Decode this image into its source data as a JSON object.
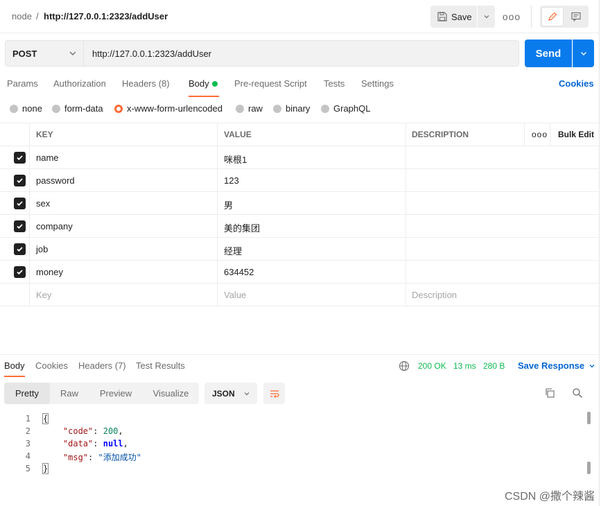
{
  "header": {
    "breadcrumb_parent": "node",
    "breadcrumb_sep": "/",
    "breadcrumb_current": "http://127.0.0.1:2323/addUser",
    "save_label": "Save",
    "more_label": "ooo"
  },
  "request": {
    "method": "POST",
    "url": "http://127.0.0.1:2323/addUser",
    "send_label": "Send"
  },
  "tabs": {
    "items": [
      {
        "label": "Params"
      },
      {
        "label": "Authorization"
      },
      {
        "label": "Headers (8)"
      },
      {
        "label": "Body"
      },
      {
        "label": "Pre-request Script"
      },
      {
        "label": "Tests"
      },
      {
        "label": "Settings"
      }
    ],
    "active": "Body",
    "cookies_label": "Cookies"
  },
  "body_types": {
    "options": [
      "none",
      "form-data",
      "x-www-form-urlencoded",
      "raw",
      "binary",
      "GraphQL"
    ],
    "selected": "x-www-form-urlencoded"
  },
  "params_table": {
    "headers": {
      "key": "KEY",
      "value": "VALUE",
      "description": "DESCRIPTION",
      "more": "ooo",
      "bulk_edit": "Bulk Edit"
    },
    "rows": [
      {
        "key": "name",
        "value": "咪根1",
        "checked": true
      },
      {
        "key": "password",
        "value": "123",
        "checked": true
      },
      {
        "key": "sex",
        "value": "男",
        "checked": true
      },
      {
        "key": "company",
        "value": "美的集团",
        "checked": true
      },
      {
        "key": "job",
        "value": "经理",
        "checked": true
      },
      {
        "key": "money",
        "value": "634452",
        "checked": true
      }
    ],
    "placeholders": {
      "key": "Key",
      "value": "Value",
      "description": "Description"
    }
  },
  "response": {
    "tabs": [
      {
        "label": "Body"
      },
      {
        "label": "Cookies"
      },
      {
        "label": "Headers (7)"
      },
      {
        "label": "Test Results"
      }
    ],
    "status": "200 OK",
    "time": "13 ms",
    "size": "280 B",
    "save_response_label": "Save Response",
    "format_tabs": [
      "Pretty",
      "Raw",
      "Preview",
      "Visualize"
    ],
    "format_active": "Pretty",
    "language": "JSON",
    "code_lines": [
      {
        "num": "1",
        "text": "{"
      },
      {
        "num": "2",
        "text": "    \"code\": 200,"
      },
      {
        "num": "3",
        "text": "    \"data\": null,"
      },
      {
        "num": "4",
        "text": "    \"msg\": \"添加成功\""
      },
      {
        "num": "5",
        "text": "}"
      }
    ]
  },
  "watermark": "CSDN @撒个辣酱",
  "colors": {
    "accent": "#ff6c37",
    "primary": "#097bed",
    "success": "#0cbb52",
    "link": "#0265d2"
  }
}
